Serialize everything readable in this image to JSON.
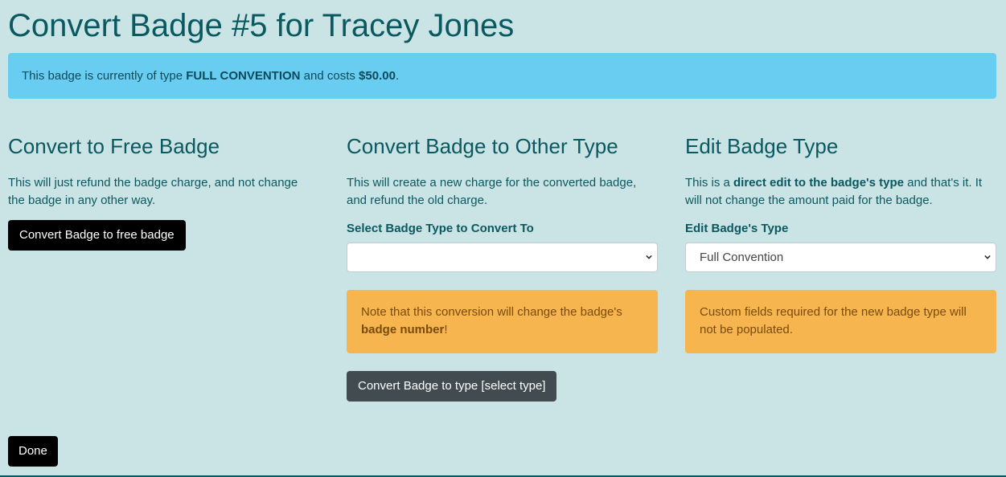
{
  "page": {
    "title": "Convert Badge #5 for Tracey Jones"
  },
  "info": {
    "prefix": "This badge is currently of type ",
    "type": "FULL CONVENTION",
    "middle": " and costs ",
    "cost": "$50.00",
    "suffix": "."
  },
  "free": {
    "heading": "Convert to Free Badge",
    "description": "This will just refund the badge charge, and not change the badge in any other way.",
    "button": "Convert Badge to free badge"
  },
  "other": {
    "heading": "Convert Badge to Other Type",
    "description": "This will create a new charge for the converted badge, and refund the old charge.",
    "select_label": "Select Badge Type to Convert To",
    "select_value": "",
    "warning_prefix": "Note that this conversion will change the badge's ",
    "warning_bold": "badge number",
    "warning_suffix": "!",
    "button": "Convert Badge to type [select type]"
  },
  "edit": {
    "heading": "Edit Badge Type",
    "desc_prefix": "This is a ",
    "desc_bold": "direct edit to the badge's type",
    "desc_suffix": " and that's it. It will not change the amount paid for the badge.",
    "select_label": "Edit Badge's Type",
    "select_value": "Full Convention",
    "warning": "Custom fields required for the new badge type will not be populated."
  },
  "done": {
    "button": "Done"
  },
  "icons": {
    "select_arrow": "chevron-down-icon"
  },
  "colors": {
    "background": "#cae4e5",
    "text": "#0b5960",
    "info": "#68cdf1",
    "warning": "#f6b54f",
    "secondary_button": "#424b50",
    "primary_button": "#000000"
  }
}
